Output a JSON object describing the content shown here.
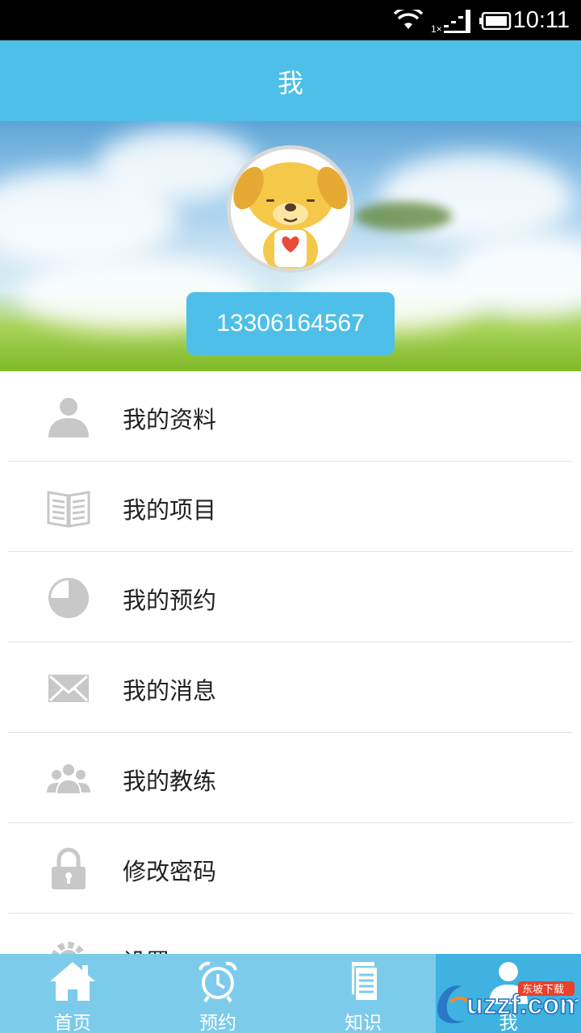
{
  "status_bar": {
    "time": "10:11",
    "network_label": "1×"
  },
  "title_bar": {
    "title": "我"
  },
  "profile": {
    "phone": "13306164567"
  },
  "menu": [
    {
      "label": "我的资料",
      "icon": "person-icon"
    },
    {
      "label": "我的项目",
      "icon": "book-icon"
    },
    {
      "label": "我的预约",
      "icon": "pie-clock-icon"
    },
    {
      "label": "我的消息",
      "icon": "envelope-icon"
    },
    {
      "label": "我的教练",
      "icon": "group-icon"
    },
    {
      "label": "修改密码",
      "icon": "lock-icon"
    },
    {
      "label": "设置",
      "icon": "gear-icon"
    }
  ],
  "bottom_nav": [
    {
      "label": "首页",
      "icon": "home-icon",
      "active": false
    },
    {
      "label": "预约",
      "icon": "alarm-clock-icon",
      "active": false
    },
    {
      "label": "知识",
      "icon": "document-icon",
      "active": false
    },
    {
      "label": "我",
      "icon": "user-icon",
      "active": true
    }
  ],
  "watermark": {
    "text": "uzzf.com",
    "badge": "东坡下载"
  },
  "colors": {
    "primary": "#4ebfe8",
    "nav_bg": "#7ccbeb",
    "nav_active": "#3fb2e1",
    "icon_gray": "#c8c8c8"
  }
}
